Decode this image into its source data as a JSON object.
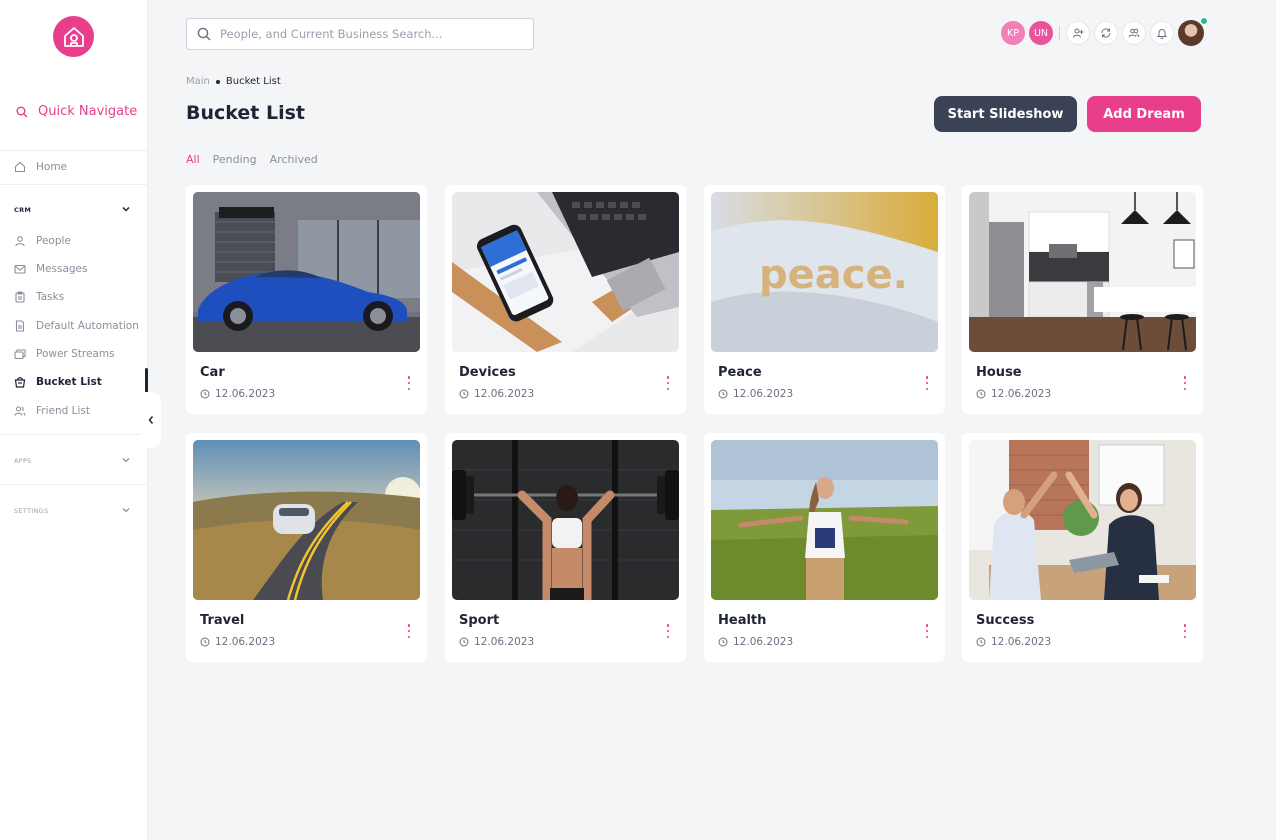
{
  "sidebar": {
    "quick_navigate": "Quick Navigate",
    "home": "Home",
    "crm_title": "CRM",
    "items": [
      {
        "label": "People",
        "icon": "person-icon"
      },
      {
        "label": "Messages",
        "icon": "mail-icon"
      },
      {
        "label": "Tasks",
        "icon": "clipboard-icon"
      },
      {
        "label": "Default Automation",
        "icon": "document-icon"
      },
      {
        "label": "Power Streams",
        "icon": "stack-icon"
      },
      {
        "label": "Bucket List",
        "icon": "bucket-icon"
      },
      {
        "label": "Friend List",
        "icon": "friends-icon"
      }
    ],
    "active_item": "Bucket List",
    "apps_title": "APPS",
    "settings_title": "SETTINGS"
  },
  "topbar": {
    "search_placeholder": "People, and Current Business Search...",
    "avatars": [
      {
        "initials": "KP",
        "color": "#f27fb5"
      },
      {
        "initials": "UN",
        "color": "#e8549a"
      }
    ],
    "icons": [
      "add-user-icon",
      "sync-icon",
      "users-icon",
      "bell-icon"
    ],
    "online_color": "#24c18f"
  },
  "breadcrumb": {
    "root": "Main",
    "current": "Bucket List"
  },
  "page": {
    "title": "Bucket List",
    "start_slideshow": "Start Slideshow",
    "add_dream": "Add Dream"
  },
  "tabs": [
    {
      "label": "All",
      "active": true
    },
    {
      "label": "Pending",
      "active": false
    },
    {
      "label": "Archived",
      "active": false
    }
  ],
  "cards": [
    {
      "title": "Car",
      "date": "12.06.2023"
    },
    {
      "title": "Devices",
      "date": "12.06.2023"
    },
    {
      "title": "Peace",
      "date": "12.06.2023",
      "image_text": "peace."
    },
    {
      "title": "House",
      "date": "12.06.2023"
    },
    {
      "title": "Travel",
      "date": "12.06.2023"
    },
    {
      "title": "Sport",
      "date": "12.06.2023"
    },
    {
      "title": "Health",
      "date": "12.06.2023"
    },
    {
      "title": "Success",
      "date": "12.06.2023"
    }
  ],
  "colors": {
    "accent": "#e83e8c",
    "dark_button": "#3b4256",
    "text": "#1f2437"
  }
}
